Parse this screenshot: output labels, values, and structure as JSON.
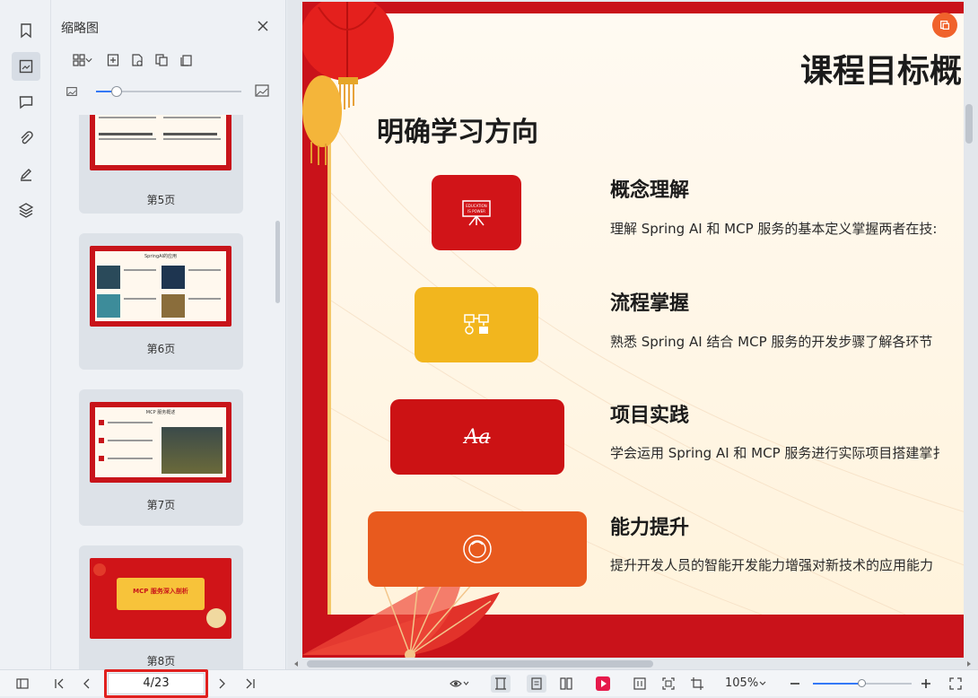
{
  "panel": {
    "title": "缩略图",
    "zoom_level": 0.14
  },
  "thumbnails": [
    {
      "label": "第5页",
      "theme": "#c8141a",
      "title_text": ""
    },
    {
      "label": "第6页",
      "theme": "#c8141a",
      "title_text": "SpringAI的应用"
    },
    {
      "label": "第7页",
      "theme": "#c8141a",
      "title_text": "MCP 服务概述"
    },
    {
      "label": "第8页",
      "theme": "#d01418",
      "title_text": "MCP 服务深入剖析"
    }
  ],
  "slide": {
    "title": "课程目标概",
    "heading": "明确学习方向",
    "items": [
      {
        "title": "概念理解",
        "desc": "理解 Spring AI 和 MCP 服务的基本定义掌握两者在技:",
        "color": "#d11418",
        "icon": "easel-icon",
        "icon_text": "EDUCATION IS POWER"
      },
      {
        "title": "流程掌握",
        "desc": "熟悉 Spring AI 结合 MCP 服务的开发步骤了解各环节",
        "color": "#f2b61e",
        "icon": "flow-icon",
        "icon_text": ""
      },
      {
        "title": "项目实践",
        "desc": "学会运用 Spring AI 和 MCP 服务进行实际项目搭建掌扌",
        "color": "#cc1214",
        "icon": "font-icon",
        "icon_text": "Aa"
      },
      {
        "title": "能力提升",
        "desc": "提升开发人员的智能开发能力增强对新技术的应用能力",
        "color": "#e85a1e",
        "icon": "person-icon",
        "icon_text": ""
      }
    ]
  },
  "bottombar": {
    "page_indicator": "4/23",
    "zoom": "105%",
    "zoom_fraction": 0.5
  },
  "colors": {
    "accent": "#3478f6",
    "slide_red": "#c9121a",
    "highlight": "#e0201e"
  }
}
